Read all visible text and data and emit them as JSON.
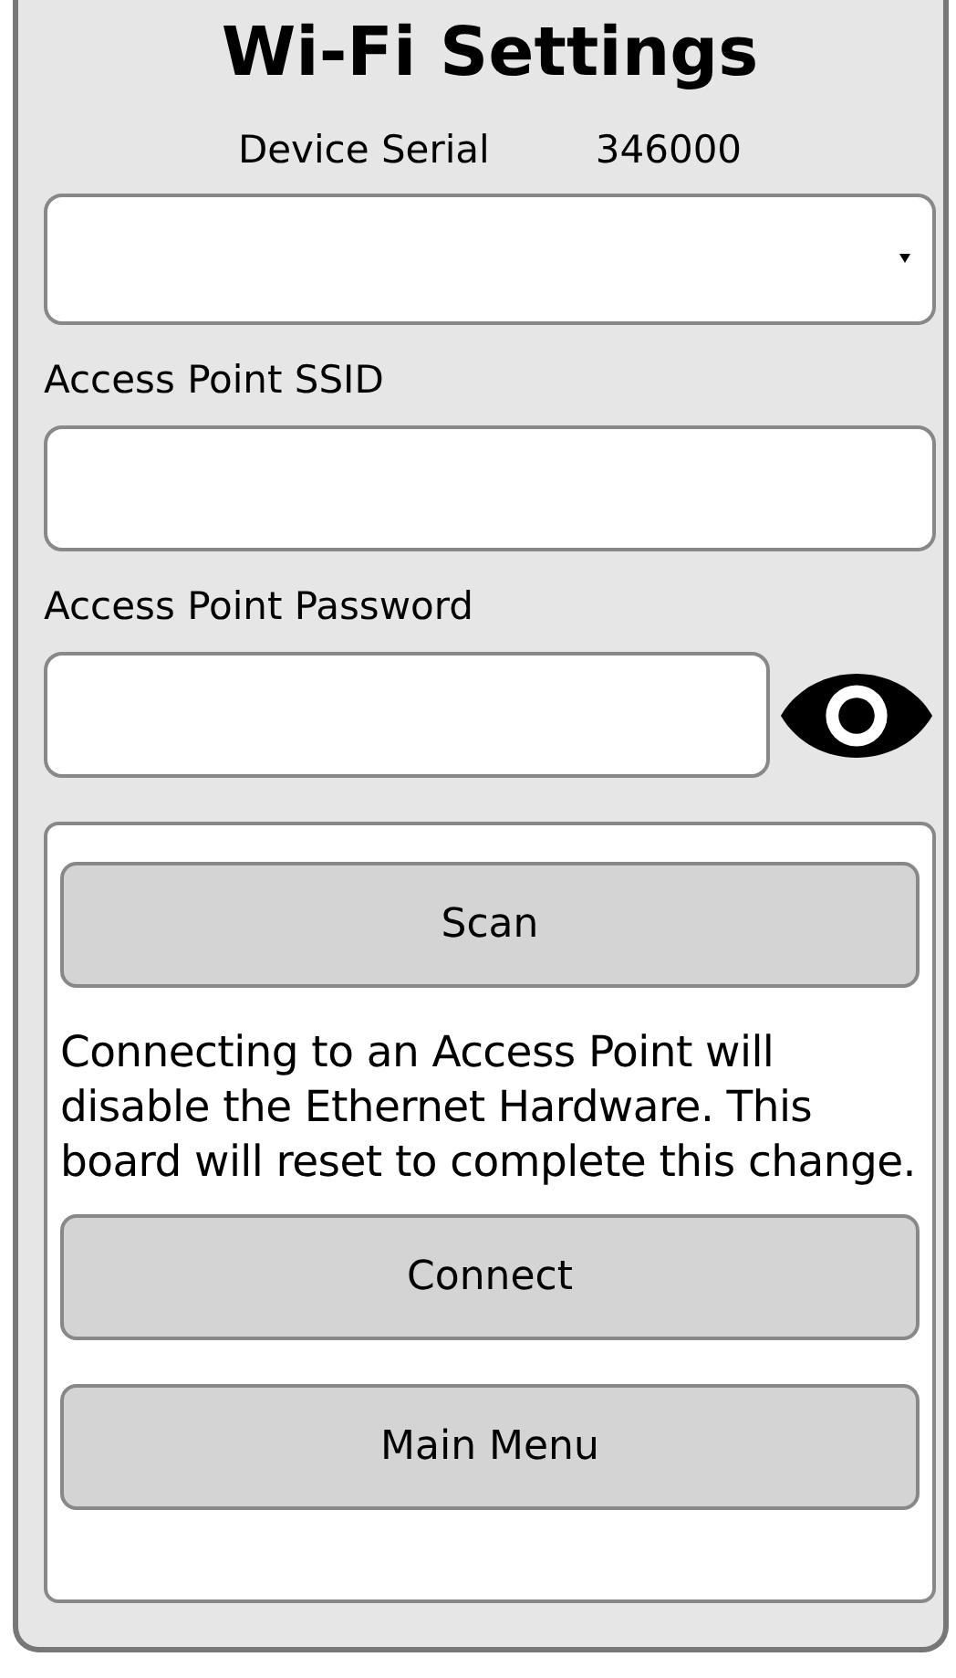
{
  "title": "Wi-Fi Settings",
  "device_serial": {
    "label": "Device Serial",
    "value": "346000"
  },
  "fields": [
    {
      "kind": "select"
    },
    {
      "label": "Access Point SSID",
      "kind": "text"
    },
    {
      "label": "Access Point Password",
      "kind": "password"
    }
  ],
  "actions": [
    {
      "kind": "button",
      "label": "Scan"
    },
    {
      "kind": "note",
      "text": "Connecting to an Access Point will disable the Ethernet Hardware. This board will reset to complete this change."
    },
    {
      "kind": "button",
      "label": "Connect"
    },
    {
      "kind": "button",
      "label": "Main Menu"
    }
  ]
}
